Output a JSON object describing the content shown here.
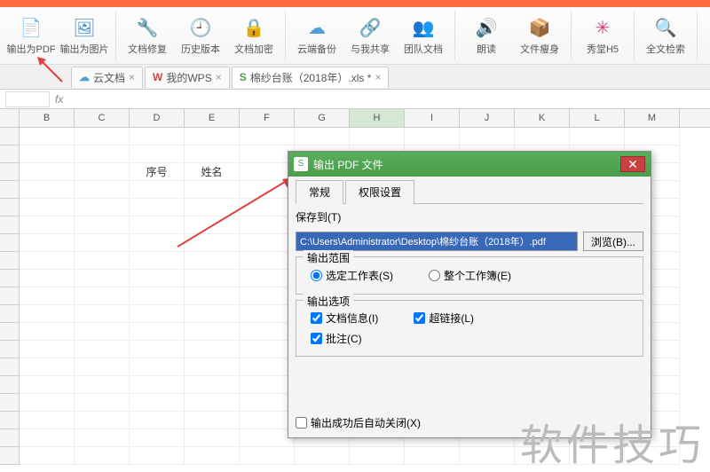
{
  "ribbon": {
    "btns": [
      {
        "label": "输出为PDF",
        "icon": "📄",
        "color": "#e06030"
      },
      {
        "label": "输出为图片",
        "icon": "🖼",
        "color": "#4a90d0"
      },
      {
        "label": "文档修复",
        "icon": "🔧",
        "color": "#7a5ab0"
      },
      {
        "label": "历史版本",
        "icon": "🕘",
        "color": "#888"
      },
      {
        "label": "文档加密",
        "icon": "🔒",
        "color": "#d08030"
      },
      {
        "label": "云端备份",
        "icon": "☁",
        "color": "#50a0d0"
      },
      {
        "label": "与我共享",
        "icon": "🔗",
        "color": "#50a0d0"
      },
      {
        "label": "团队文档",
        "icon": "👥",
        "color": "#50a0d0"
      },
      {
        "label": "朗读",
        "icon": "🔊",
        "color": "#888"
      },
      {
        "label": "文件瘦身",
        "icon": "📦",
        "color": "#888"
      },
      {
        "label": "秀堂H5",
        "icon": "✳",
        "color": "#d04080"
      },
      {
        "label": "全文检索",
        "icon": "🔍",
        "color": "#888"
      }
    ]
  },
  "doctabs": [
    {
      "icon": "☁",
      "label": "云文档",
      "color": "#50a0d0"
    },
    {
      "icon": "W",
      "label": "我的WPS",
      "color": "#d04040"
    },
    {
      "icon": "S",
      "label": "棉纱台账（2018年）.xls *",
      "color": "#4a9d4a",
      "active": true
    }
  ],
  "fx_label": "fx",
  "cols": [
    "B",
    "C",
    "D",
    "E",
    "F",
    "G",
    "H",
    "I",
    "J",
    "K",
    "L",
    "M"
  ],
  "selected_col": "H",
  "cells": {
    "D3": "序号",
    "E3": "姓名"
  },
  "dialog": {
    "title": "输出 PDF 文件",
    "tabs": [
      "常规",
      "权限设置"
    ],
    "save_label": "保存到(T)",
    "path": "C:\\Users\\Administrator\\Desktop\\棉纱台账（2018年）.pdf",
    "browse": "浏览(B)...",
    "range_legend": "输出范围",
    "range_sel": "选定工作表(S)",
    "range_all": "整个工作簿(E)",
    "opts_legend": "输出选项",
    "opt_doc": "文档信息(I)",
    "opt_link": "超链接(L)",
    "opt_note": "批注(C)",
    "auto_close": "输出成功后自动关闭(X)"
  },
  "watermark": "软件技巧"
}
